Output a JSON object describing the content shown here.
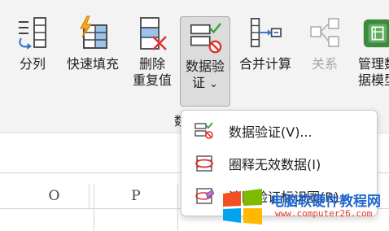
{
  "ribbon": {
    "buttons": {
      "split": {
        "label": "分列",
        "icon": "text-to-columns-icon"
      },
      "fill": {
        "label": "快速填充",
        "icon": "flash-fill-icon"
      },
      "dedupe": {
        "line1": "删除",
        "line2": "重复值",
        "icon": "remove-duplicates-icon"
      },
      "validation": {
        "line1": "数据验",
        "line2": "证",
        "caret": "⌄",
        "icon": "data-validation-icon"
      },
      "consolidate": {
        "label": "合并计算",
        "icon": "consolidate-icon"
      },
      "relations": {
        "label": "关系",
        "icon": "relationships-icon",
        "disabled": true
      },
      "model": {
        "line1": "管理数",
        "line2": "据模型",
        "icon": "data-model-icon"
      }
    },
    "group_label_fragment": "数"
  },
  "sheet": {
    "columns": [
      "O",
      "P"
    ]
  },
  "dropdown": {
    "items": [
      {
        "label": "数据验证(V)...",
        "icon": "data-validation-icon"
      },
      {
        "label": "圈释无效数据(I)",
        "icon": "circle-invalid-data-icon"
      },
      {
        "label": "清除验证标识圈(R)",
        "icon": "clear-validation-circles-icon"
      }
    ]
  },
  "watermark": {
    "title": "电脑软硬件教程网",
    "url": "www.computer26.com"
  },
  "colors": {
    "accent_blue": "#2e75c7",
    "error_red": "#e0322c",
    "check_green": "#3aa23a",
    "ribbon_bg": "#f3f3f3",
    "pressed_bg": "#dcdcdc",
    "disabled_text": "#a6a6a6"
  }
}
